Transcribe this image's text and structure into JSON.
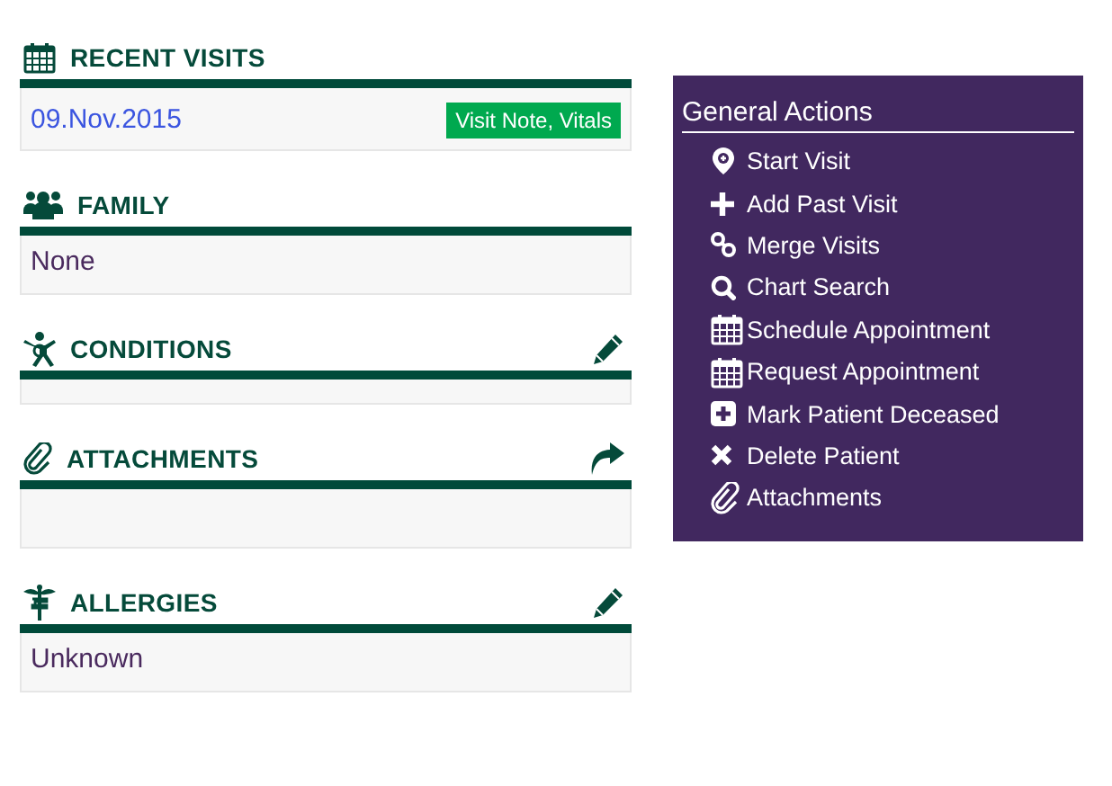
{
  "sections": [
    {
      "kind": "calendar",
      "title": "RECENT VISITS",
      "body": {
        "kind": "visits",
        "visits": [
          {
            "date": "09.Nov.2015",
            "tag": "Visit Note, Vitals"
          }
        ]
      }
    },
    {
      "kind": "people",
      "title": "FAMILY",
      "body": {
        "kind": "text",
        "text": "None"
      }
    },
    {
      "kind": "person",
      "title": "CONDITIONS",
      "body": {
        "kind": "empty"
      }
    },
    {
      "kind": "paperclip",
      "title": "ATTACHMENTS",
      "body": {
        "kind": "tall"
      }
    },
    {
      "kind": "caduceus",
      "title": "ALLERGIES",
      "body": {
        "kind": "text",
        "text": "Unknown"
      }
    }
  ],
  "actions": {
    "title": "General Actions",
    "items": [
      {
        "kind": "pin",
        "label": "Start Visit"
      },
      {
        "kind": "plus",
        "label": "Add Past Visit"
      },
      {
        "kind": "link",
        "label": "Merge Visits"
      },
      {
        "kind": "search",
        "label": "Chart Search"
      },
      {
        "kind": "calendar",
        "label": "Schedule Appointment"
      },
      {
        "kind": "calendar",
        "label": "Request Appointment"
      },
      {
        "kind": "plus-square",
        "label": "Mark Patient Deceased"
      },
      {
        "kind": "cross",
        "label": "Delete Patient"
      },
      {
        "kind": "paperclip",
        "label": "Attachments"
      }
    ]
  }
}
